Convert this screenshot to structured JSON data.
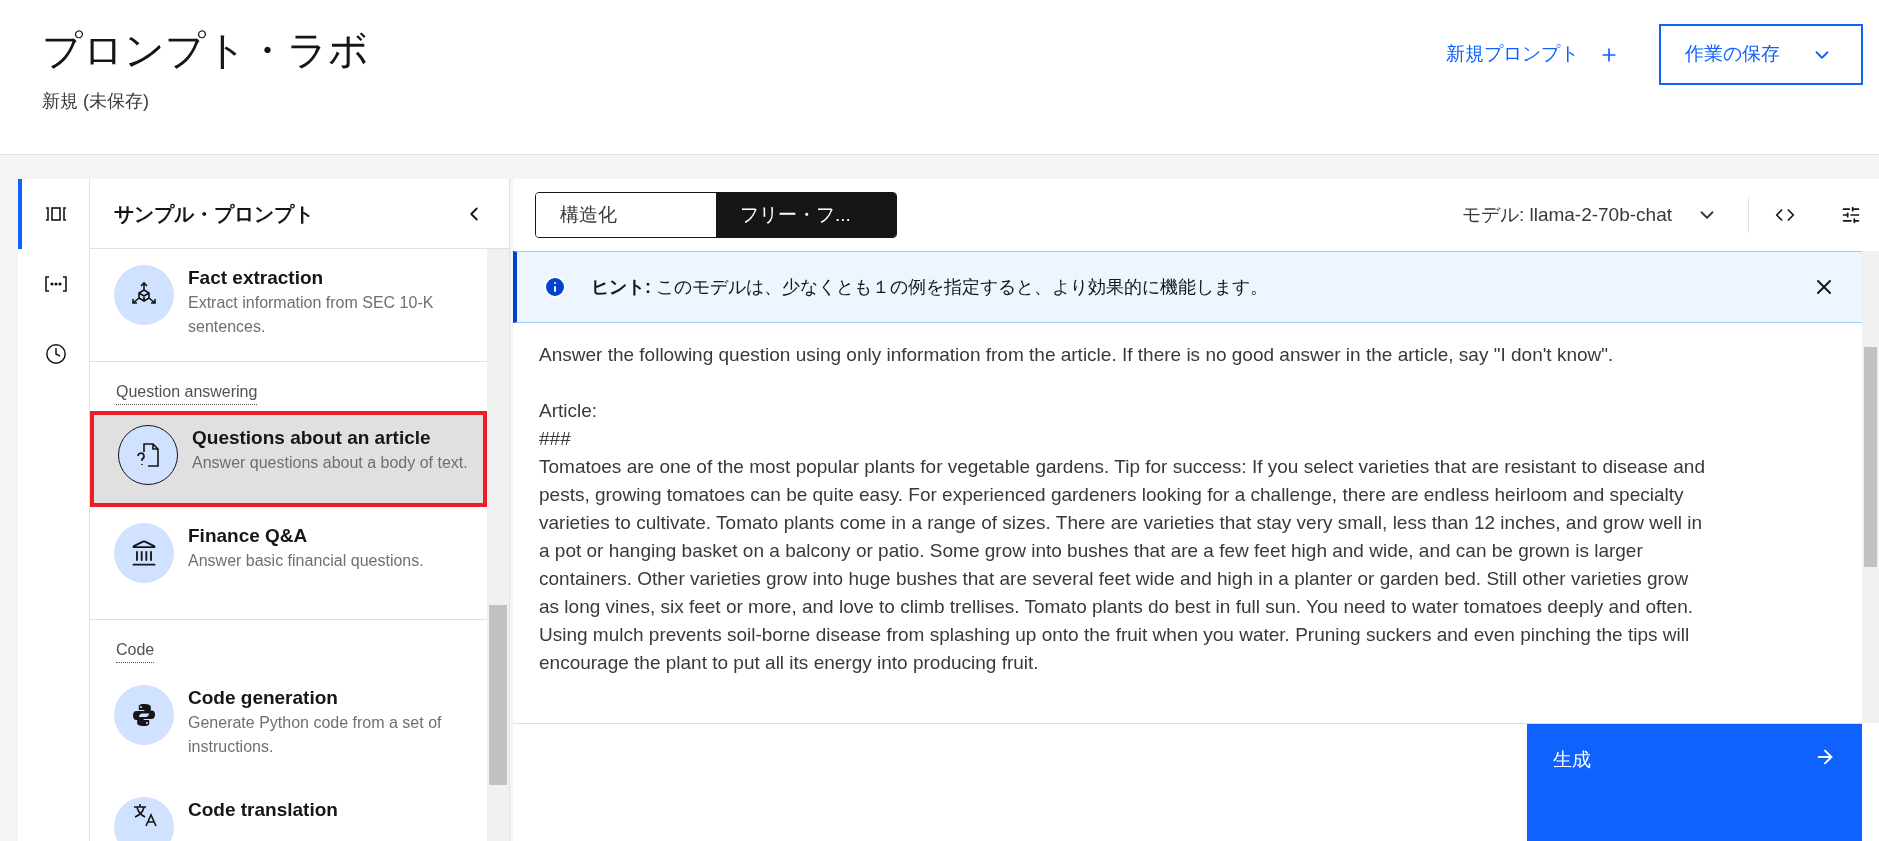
{
  "header": {
    "title": "プロンプト・ラボ",
    "subtitle": "新規 (未保存)",
    "new_prompt": "新規プロンプト",
    "save": "作業の保存"
  },
  "rail": [
    {
      "kind": "samples",
      "selected": true
    },
    {
      "kind": "variables",
      "selected": false
    },
    {
      "kind": "history",
      "selected": false
    }
  ],
  "sidebar": {
    "title": "サンプル・プロンプト",
    "items": [
      {
        "kind": "prompt",
        "title": "Fact extraction",
        "description": "Extract information from SEC 10-K sentences.",
        "selected": false
      },
      {
        "kind": "category",
        "title": "Question answering"
      },
      {
        "kind": "prompt",
        "title": "Questions about an article",
        "description": "Answer questions about a body of text.",
        "selected": true
      },
      {
        "kind": "prompt",
        "title": "Finance Q&A",
        "description": "Answer basic financial questions.",
        "selected": false
      },
      {
        "kind": "category",
        "title": "Code"
      },
      {
        "kind": "prompt",
        "title": "Code generation",
        "description": "Generate Python code from a set of instructions.",
        "selected": false
      },
      {
        "kind": "prompt",
        "title": "Code translation",
        "selected": false
      }
    ]
  },
  "editor": {
    "modes": [
      {
        "label": "構造化",
        "selected": false
      },
      {
        "label": "フリー・フ...",
        "selected": true
      }
    ],
    "model": "モデル: llama-2-70b-chat",
    "hint": {
      "label": "ヒント:",
      "text": "このモデルは、少なくとも１の例を指定すると、より効果的に機能します。"
    },
    "prompt": [
      {
        "lines": [
          "Answer the following question using only information from the article. If there is no good answer in the article, say \"I don't know\"."
        ]
      },
      {
        "lines": [
          "Article:",
          "###",
          "Tomatoes are one of the most popular plants for vegetable gardens. Tip for success: If you select varieties that are resistant to disease and pests, growing tomatoes can be quite easy. For experienced gardeners looking for a challenge, there are endless heirloom and specialty varieties to cultivate. Tomato plants come in a range of sizes. There are varieties that stay very small, less than 12 inches, and grow well in a pot or hanging basket on a balcony or patio. Some grow into bushes that are a few feet high and wide, and can be grown is larger containers. Other varieties grow into huge bushes that are several feet wide and high in a planter or garden bed. Still other varieties grow as long vines, six feet or more, and love to climb trellises. Tomato plants do best in full sun. You need to water tomatoes deeply and often. Using mulch prevents soil-borne disease from splashing up onto the fruit when you water. Pruning suckers and even pinching the tips will encourage the plant to put all its energy into producing fruit."
        ]
      }
    ],
    "generate": "生成"
  }
}
